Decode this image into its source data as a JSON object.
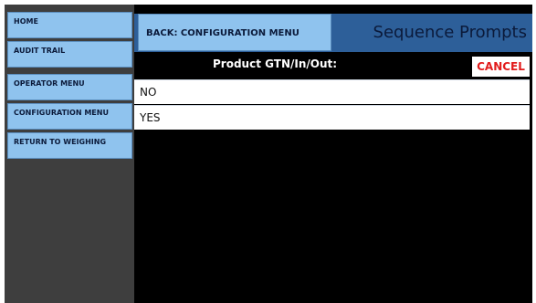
{
  "sidebar": {
    "items": [
      {
        "label": "HOME"
      },
      {
        "label": "AUDIT TRAIL"
      },
      {
        "label": "OPERATOR MENU"
      },
      {
        "label": "CONFIGURATION MENU"
      },
      {
        "label": "RETURN TO WEIGHING"
      }
    ]
  },
  "header": {
    "back_label": "BACK: CONFIGURATION MENU",
    "title": "Sequence Prompts"
  },
  "prompt": {
    "label": "Product GTN/In/Out:",
    "cancel_label": "CANCEL"
  },
  "options": [
    {
      "label": "NO"
    },
    {
      "label": "YES"
    }
  ],
  "colors": {
    "button_blue": "#8fc3ee",
    "header_blue": "#2d5f99",
    "cancel_red": "#e21b1b",
    "sidebar_bg": "#3e3e3e"
  }
}
